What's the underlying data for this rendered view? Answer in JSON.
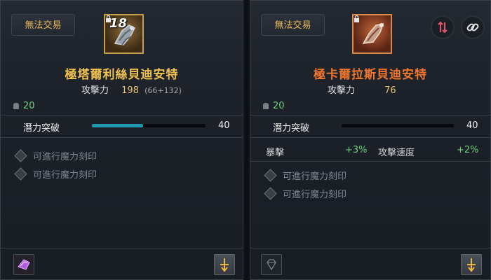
{
  "left": {
    "trade_label": "無法交易",
    "upgrade_level": "18",
    "name": "極塔爾利絲貝迪安特",
    "stat_label": "攻擊力",
    "stat_value": "198",
    "stat_breakdown": "(66+132)",
    "item_level": "20",
    "potential_label": "潛力突破",
    "potential_value": "40",
    "potential_fill_fraction": 0.45,
    "engravings": [
      "可進行魔力刻印",
      "可進行魔力刻印"
    ]
  },
  "right": {
    "trade_label": "無法交易",
    "name": "極卡爾拉斯貝迪安特",
    "stat_label": "攻擊力",
    "stat_value": "76",
    "item_level": "20",
    "potential_label": "潛力突破",
    "potential_value": "40",
    "potential_fill_fraction": 0,
    "bonuses": [
      {
        "label": "暴擊",
        "value": "+3%"
      },
      {
        "label": "攻擊速度",
        "value": "+2%"
      }
    ],
    "engravings": [
      "可進行魔力刻印",
      "可進行魔力刻印"
    ]
  },
  "colors": {
    "legend_name": "#f2c24f",
    "relic_name": "#f0762c",
    "trade_text": "#e7b95a",
    "bonus_green": "#6fd07a",
    "potential_bar": "#1e99b0"
  },
  "icons": [
    "gauntlet-item-icon",
    "lock-icon",
    "purple-gem-icon",
    "upgrade-arrow-icon",
    "empty-gem-slot-icon",
    "swap-icon",
    "link-icon",
    "diamond-slot-icon",
    "bag-icon"
  ]
}
